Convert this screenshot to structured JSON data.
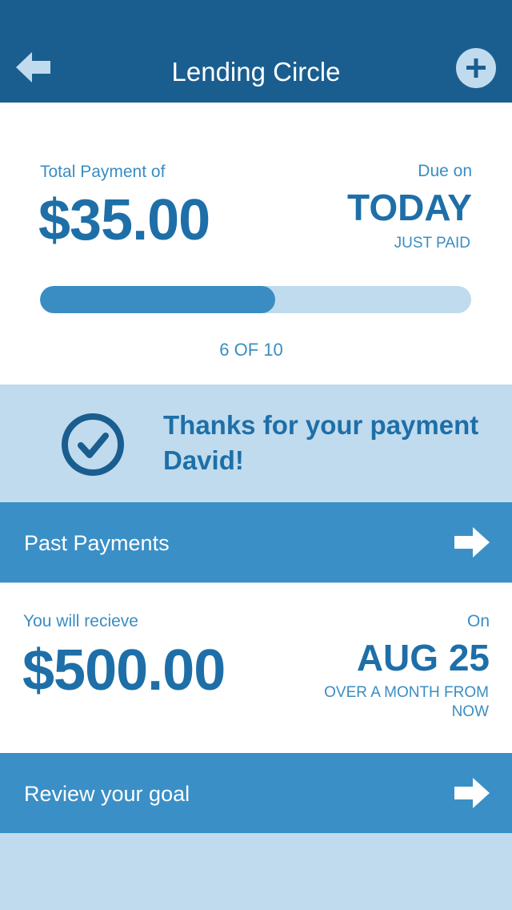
{
  "header": {
    "title": "Lending Circle",
    "back_icon": "arrow-left-icon",
    "add_icon": "plus-circle-icon"
  },
  "payment": {
    "total_label": "Total Payment of",
    "total_amount": "$35.00",
    "due_label": "Due on",
    "due_value": "TODAY",
    "due_status": "JUST PAID",
    "progress_fraction": 0.545,
    "progress_text": "6 OF 10"
  },
  "thanks": {
    "icon": "check-circle-icon",
    "message": "Thanks for your payment David!"
  },
  "past_payments": {
    "label": "Past Payments",
    "icon": "arrow-right-icon"
  },
  "receive": {
    "label": "You will recieve",
    "amount": "$500.00",
    "on_label": "On",
    "date": "AUG 25",
    "note": "OVER A MONTH FROM NOW"
  },
  "review_goal": {
    "label": "Review your goal",
    "icon": "arrow-right-icon"
  },
  "colors": {
    "header_bg": "#1a5e90",
    "accent": "#3a8dc2",
    "text_strong": "#1e6fa8",
    "light_bg": "#c0dbee",
    "check": "#1a5e90"
  }
}
